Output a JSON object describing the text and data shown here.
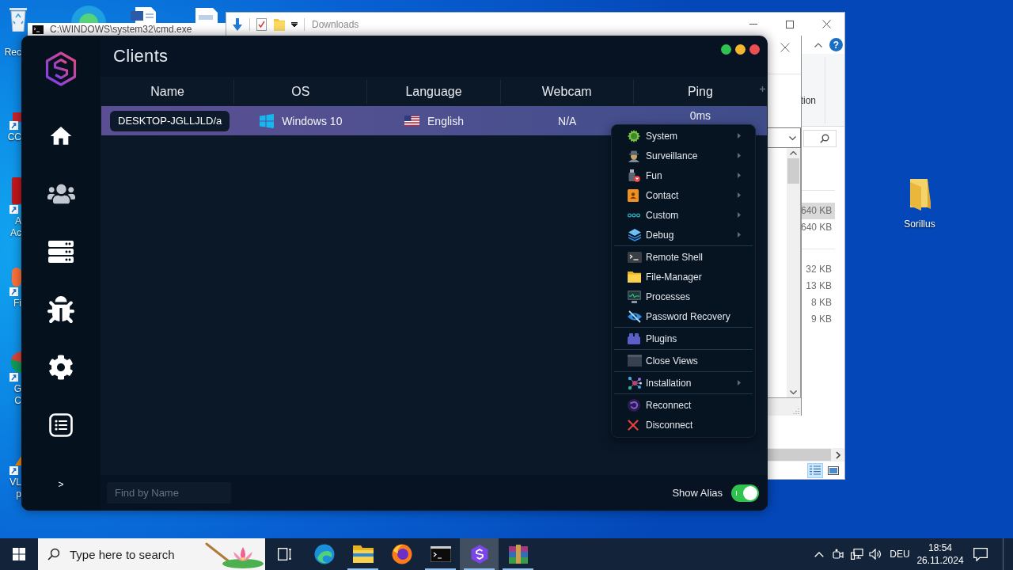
{
  "desktop": {
    "icons": [
      {
        "lines": [
          "Rec"
        ]
      },
      {
        "lines": [
          "CC"
        ]
      },
      {
        "lines": [
          "A",
          "Ac"
        ]
      },
      {
        "lines": [
          "Fi"
        ]
      },
      {
        "lines": [
          "G",
          "C"
        ]
      },
      {
        "lines": [
          "VL",
          "p"
        ]
      }
    ],
    "folder": {
      "label": "Sorillus"
    }
  },
  "cmd_window": {
    "title": "C:\\WINDOWS\\system32\\cmd.exe"
  },
  "explorer_window": {
    "title": "Downloads",
    "ribbon_text": "tion",
    "help_label": "?",
    "size_groups": [
      [
        {
          "text": "640 KB",
          "selected": true
        },
        {
          "text": "640 KB",
          "selected": false
        }
      ],
      [
        {
          "text": "32 KB",
          "selected": false
        },
        {
          "text": "13 KB",
          "selected": false
        },
        {
          "text": "8 KB",
          "selected": false
        },
        {
          "text": "9 KB",
          "selected": false
        }
      ]
    ],
    "views": [
      {
        "selected": true
      },
      {
        "selected": false
      }
    ]
  },
  "app": {
    "title": "Clients",
    "sidebar": {
      "items": [
        {
          "selected": false
        },
        {
          "selected": true
        },
        {
          "selected": false
        },
        {
          "selected": false
        },
        {
          "selected": false
        },
        {
          "selected": false
        }
      ],
      "expand_label": ">"
    },
    "table": {
      "columns": [
        "Name",
        "OS",
        "Language",
        "Webcam",
        "Ping"
      ],
      "rows": [
        {
          "selected": true,
          "name": "DESKTOP-JGLLJLD/a",
          "os": "Windows 10",
          "language": "English",
          "webcam": "N/A",
          "ping": "0ms"
        }
      ]
    },
    "search": {
      "placeholder": "Find by Name"
    },
    "alias_toggle": {
      "label": "Show Alias",
      "on": true
    }
  },
  "context_menu": {
    "groups": [
      [
        {
          "label": "System",
          "submenu": true
        },
        {
          "label": "Surveillance",
          "submenu": true
        },
        {
          "label": "Fun",
          "submenu": true
        },
        {
          "label": "Contact",
          "submenu": true
        },
        {
          "label": "Custom",
          "submenu": true
        },
        {
          "label": "Debug",
          "submenu": true
        }
      ],
      [
        {
          "label": "Remote Shell",
          "submenu": false
        },
        {
          "label": "File-Manager",
          "submenu": false
        },
        {
          "label": "Processes",
          "submenu": false
        },
        {
          "label": "Password Recovery",
          "submenu": false
        }
      ],
      [
        {
          "label": "Plugins",
          "submenu": false
        }
      ],
      [
        {
          "label": "Close Views",
          "submenu": false
        }
      ],
      [
        {
          "label": "Installation",
          "submenu": true
        }
      ],
      [
        {
          "label": "Reconnect",
          "submenu": false
        },
        {
          "label": "Disconnect",
          "submenu": false
        }
      ]
    ]
  },
  "taskbar": {
    "search_placeholder": "Type here to search",
    "apps": [
      {
        "running": false,
        "selected": false
      },
      {
        "running": true,
        "selected": false
      },
      {
        "running": false,
        "selected": false
      },
      {
        "running": true,
        "selected": false
      },
      {
        "running": true,
        "selected": true
      },
      {
        "running": true,
        "selected": false
      }
    ],
    "language": "DEU",
    "time": "18:54",
    "date": "26.11.2024"
  }
}
